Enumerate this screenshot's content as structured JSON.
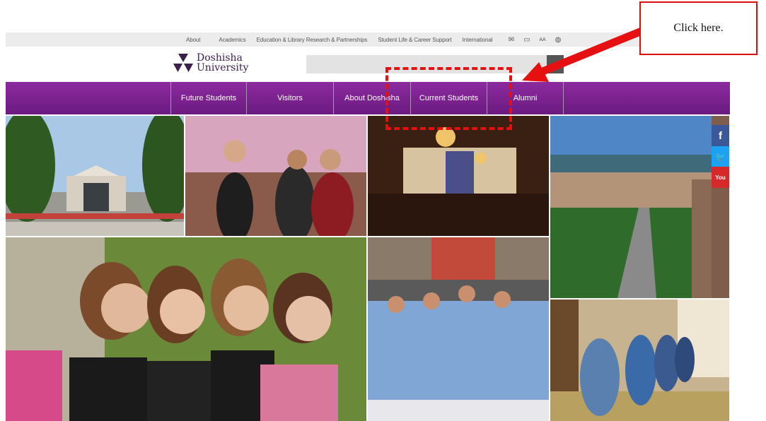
{
  "top_links": [
    "About",
    "Academics",
    "Education & Library Research & Partnerships",
    "Student Life & Career Support",
    "International"
  ],
  "top_icons": [
    "mail-icon",
    "bookmark-icon",
    "font-size-icon",
    "globe-icon"
  ],
  "top_icon_glyphs": {
    "mail": "✉",
    "bookmark": "▭",
    "font": "AA",
    "globe": "◍"
  },
  "logo": {
    "line1": "Doshisha",
    "line2": "University"
  },
  "search": {
    "placeholder": ""
  },
  "nav": [
    "Future Students",
    "Visitors",
    "About Doshisha",
    "Current Students",
    "Alumni"
  ],
  "social": [
    {
      "name": "facebook",
      "glyph": "f",
      "color": "#3b5998"
    },
    {
      "name": "twitter",
      "glyph": "🐦",
      "color": "#1da1f2"
    },
    {
      "name": "youtube",
      "glyph": "You",
      "color": "#d62a2a"
    }
  ],
  "annotation": {
    "callout": "Click here."
  },
  "colors": {
    "nav": "#7a2290",
    "accent": "#e10c0c",
    "logo": "#3c1f4c"
  }
}
